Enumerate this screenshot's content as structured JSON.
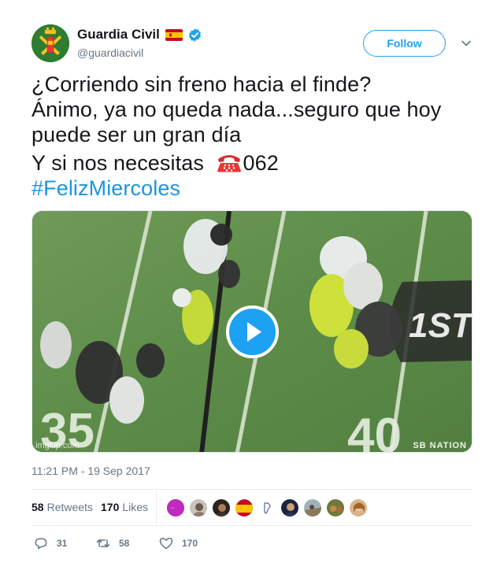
{
  "author": {
    "display_name": "Guardia Civil",
    "handle": "@guardiacivil",
    "flag_icon": "spain-flag-icon",
    "verified_icon": "verified-badge-icon",
    "accent_color": "#1da1f2"
  },
  "follow_button": {
    "label": "Follow"
  },
  "tweet": {
    "lines": [
      "¿Corriendo sin freno hacia el finde?",
      "Ánimo, ya no queda nada...seguro que hoy",
      "puede ser un gran día",
      "Y si nos necesitas ",
      "062"
    ],
    "emoji": "telephone-emoji",
    "hashtag": "#FelizMiercoles"
  },
  "media": {
    "type": "gif",
    "watermark_left": "imgflip.com",
    "watermark_right": "SB NATION",
    "field_marker": "1ST",
    "yard_left": "35",
    "yard_right": "40",
    "play_icon": "play-icon"
  },
  "timestamp": "11:21 PM - 19 Sep 2017",
  "stats": {
    "retweets_count": "58",
    "retweets_label": "Retweets",
    "likes_count": "170",
    "likes_label": "Likes"
  },
  "actions": {
    "replies": "31",
    "retweets": "58",
    "likes": "170"
  }
}
